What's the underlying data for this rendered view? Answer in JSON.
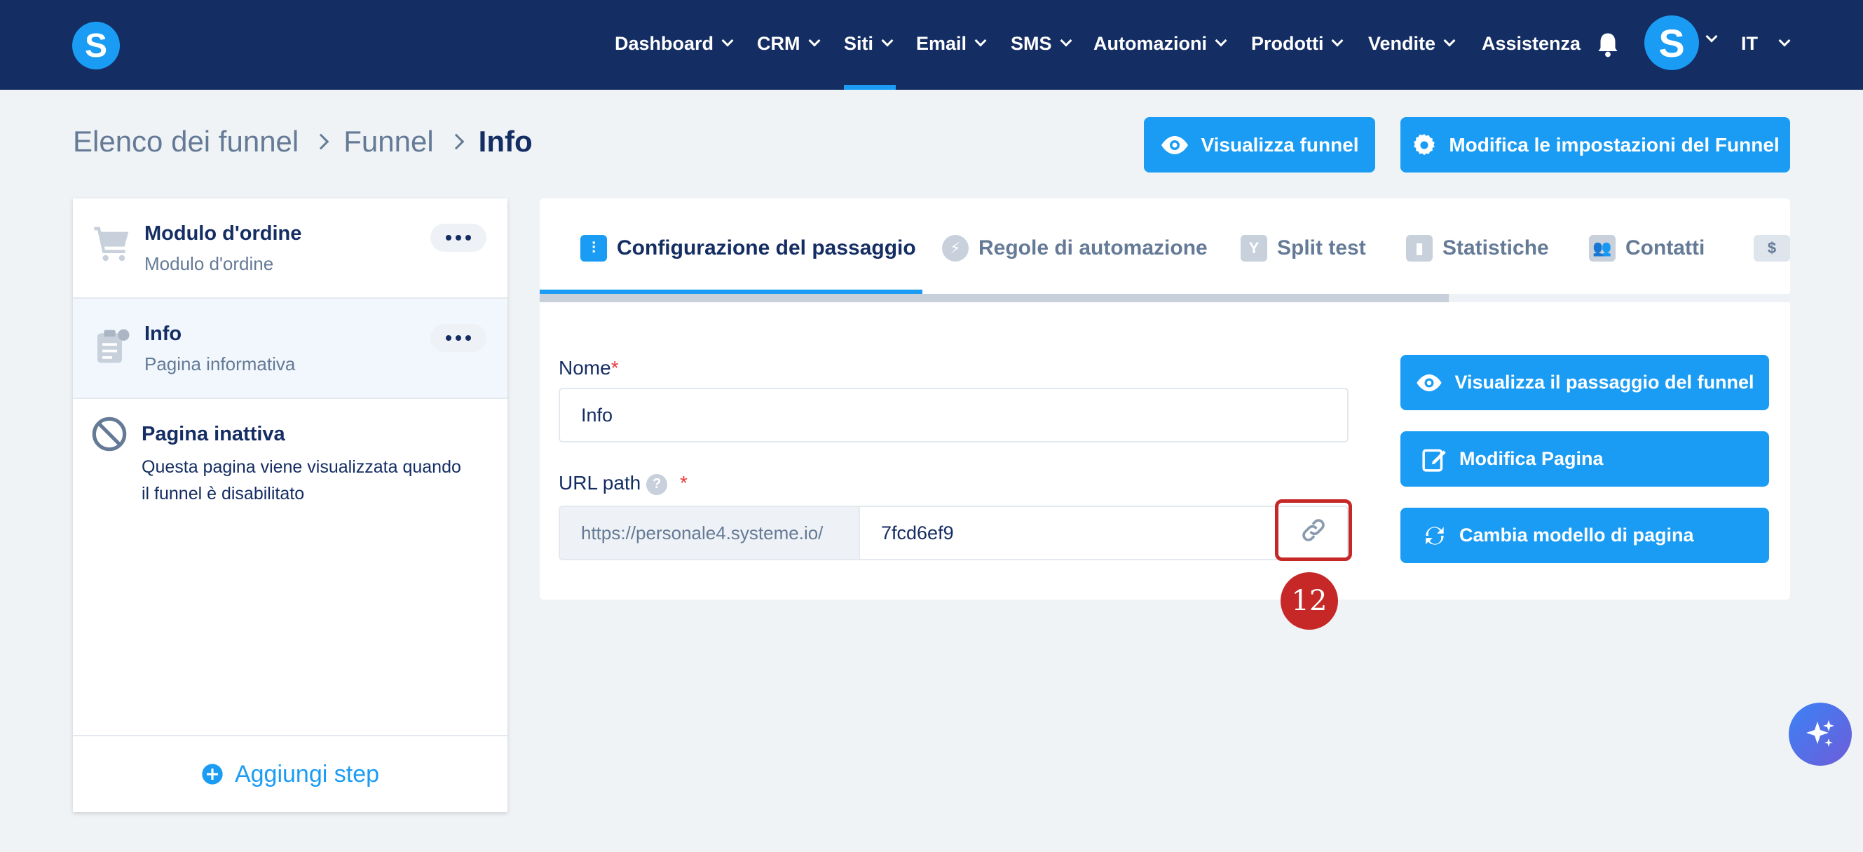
{
  "nav": {
    "items": [
      {
        "label": "Dashboard"
      },
      {
        "label": "CRM"
      },
      {
        "label": "Siti"
      },
      {
        "label": "Email"
      },
      {
        "label": "SMS"
      },
      {
        "label": "Automazioni"
      },
      {
        "label": "Prodotti"
      },
      {
        "label": "Vendite"
      },
      {
        "label": "Assistenza"
      }
    ],
    "active": "Siti",
    "logo_letter": "S",
    "avatar_letter": "S",
    "language": "IT",
    "icons": {
      "bell": "bell-icon"
    }
  },
  "breadcrumb": {
    "items": [
      "Elenco dei funnel",
      "Funnel",
      "Info"
    ]
  },
  "header_buttons": {
    "view_funnel": "Visualizza funnel",
    "edit_settings": "Modifica le impostazioni del Funnel"
  },
  "sidebar": {
    "steps": [
      {
        "title": "Modulo d'ordine",
        "subtitle": "Modulo d'ordine",
        "icon": "cart-icon"
      },
      {
        "title": "Info",
        "subtitle": "Pagina informativa",
        "icon": "clipboard-info-icon"
      },
      {
        "title": "Pagina inattiva",
        "subtitle": "Questa pagina viene visualizzata quando il funnel è disabilitato",
        "icon": "ban-icon"
      }
    ],
    "add_step": "Aggiungi step"
  },
  "tabs": [
    {
      "label": "Configurazione del passaggio",
      "icon": "sliders-icon",
      "active": true
    },
    {
      "label": "Regole di automazione",
      "icon": "bolt-icon",
      "active": false
    },
    {
      "label": "Split test",
      "icon": "split-icon",
      "active": false
    },
    {
      "label": "Statistiche",
      "icon": "bar-chart-icon",
      "active": false
    },
    {
      "label": "Contatti",
      "icon": "users-icon",
      "active": false
    },
    {
      "label": "$",
      "icon": "dollar-icon",
      "active": false
    }
  ],
  "form": {
    "name_label": "Nome",
    "name_value": "Info",
    "url_label": "URL path",
    "url_prefix": "https://personale4.systeme.io/",
    "url_value": "7fcd6ef9",
    "required_mark": "*",
    "help_mark": "?"
  },
  "actions": {
    "view_step": "Visualizza il passaggio del funnel",
    "edit_page": "Modifica Pagina",
    "change_template": "Cambia modello di pagina"
  },
  "annotation": {
    "number": "12"
  },
  "colors": {
    "nav_bg": "#142d63",
    "accent": "#1a9cf4",
    "annotation": "#c62828"
  }
}
